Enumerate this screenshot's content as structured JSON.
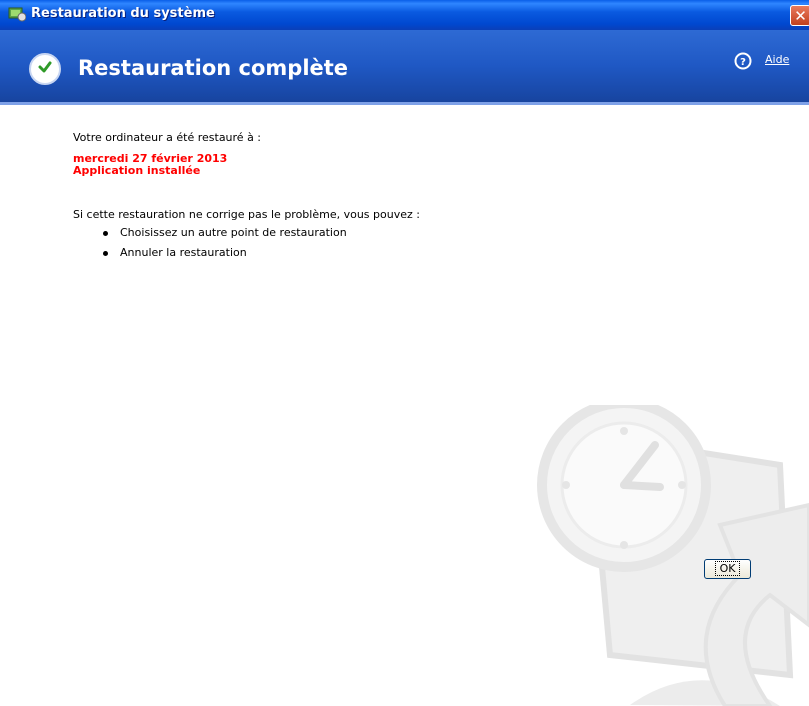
{
  "window": {
    "title": "Restauration du système"
  },
  "header": {
    "title": "Restauration complète",
    "help_label": "Aide"
  },
  "content": {
    "restored_label": "Votre ordinateur a été restauré à :",
    "restore_date": "mercredi 27 février 2013",
    "restore_event": "Application installée",
    "note": "Si cette restauration ne corrige pas le problème, vous pouvez :",
    "options": [
      "Choisissez un autre point de restauration",
      "Annuler la restauration"
    ]
  },
  "buttons": {
    "ok": "OK"
  },
  "colors": {
    "highlight": "#ff0000",
    "titlebar": "#0a5ae0",
    "header": "#1f58c4"
  }
}
